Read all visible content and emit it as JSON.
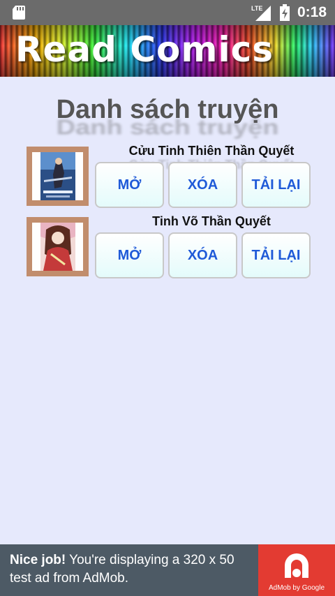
{
  "status_bar": {
    "network": "LTE",
    "time": "0:18"
  },
  "app": {
    "banner_title": "Read Comics"
  },
  "page": {
    "heading": "Danh sách truyện"
  },
  "comics": [
    {
      "title": "Cửu Tinh Thiên Thần Quyết",
      "open_label": "MỞ",
      "delete_label": "XÓA",
      "reload_label": "TẢI LẠI"
    },
    {
      "title": "Tinh Võ Thần Quyết",
      "open_label": "MỞ",
      "delete_label": "XÓA",
      "reload_label": "TẢI LẠI"
    }
  ],
  "ad": {
    "headline": "Nice job!",
    "body": " You're displaying a 320 x 50 test ad from AdMob.",
    "brand": "AdMob by Google"
  },
  "colors": {
    "background": "#e6e9fc",
    "button_text": "#1f5ad8",
    "ad_red": "#e33b32",
    "thumb_frame": "#c18d6d"
  }
}
